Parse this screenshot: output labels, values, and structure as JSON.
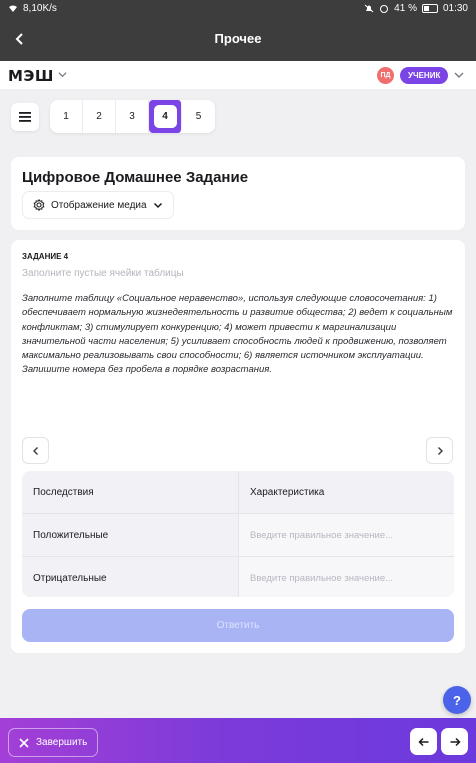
{
  "status_bar": {
    "speed": "8,10K/s",
    "battery": "41 %",
    "time": "01:30"
  },
  "app_bar": {
    "title": "Прочее"
  },
  "header": {
    "logo": "МЭШ",
    "avatar_initials": "ПД",
    "role": "УЧЕНИК"
  },
  "tabs": [
    "1",
    "2",
    "3",
    "4",
    "5"
  ],
  "active_tab": "4",
  "homework": {
    "title": "Цифровое Домашнее Задание",
    "media_button": "Отображение медиа"
  },
  "task": {
    "label": "ЗАДАНИЕ 4",
    "subtitle": "Заполните пустые ячейки таблицы",
    "text": "Заполните таблицу «Социальное неравенство», используя следующие словосочетания: 1) обеспечивает нормальную жизнедеятельность и развитие общества; 2) ведет к социальным конфликтам; 3) стимулирует конкуренцию; 4) может привести к маргинализации значительной части населения; 5) усиливает способность людей к продвижению, позволяет максимально реализовывать свои способности; 6) является источником эксплуатации. Запишите номера без пробела в порядке возрастания."
  },
  "table": {
    "headers": [
      "Последствия",
      "Характеристика"
    ],
    "rows": [
      {
        "label": "Положительные",
        "placeholder": "Введите правильное значение..."
      },
      {
        "label": "Отрицательные",
        "placeholder": "Введите правильное значение..."
      }
    ]
  },
  "answer_button": "Ответить",
  "help_button": "?",
  "bottom_bar": {
    "finish_label": "Завершить"
  },
  "colors": {
    "accent": "#7a44e6",
    "answer_disabled": "#a9b4f5",
    "help": "#4b63e8"
  }
}
